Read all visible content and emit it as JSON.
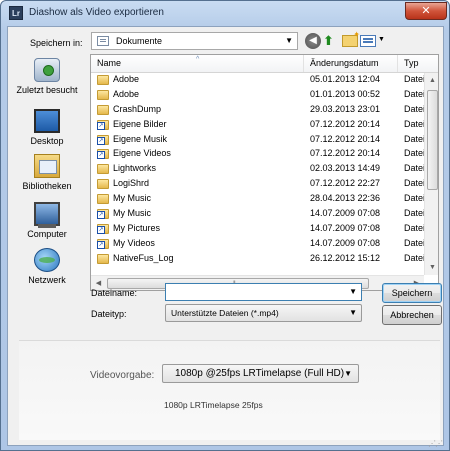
{
  "window": {
    "title": "Diashow als Video exportieren",
    "app_icon_text": "Lr",
    "close_glyph": "✕"
  },
  "toolbar": {
    "look_in_label": "Speichern in:",
    "look_in_value": "Dokumente",
    "icons": [
      "back-icon",
      "up-folder-icon",
      "new-folder-icon",
      "view-menu-icon"
    ]
  },
  "places": [
    {
      "label": "Zuletzt besucht",
      "icon": "recent-places-icon"
    },
    {
      "label": "Desktop",
      "icon": "desktop-icon"
    },
    {
      "label": "Bibliotheken",
      "icon": "libraries-icon"
    },
    {
      "label": "Computer",
      "icon": "computer-icon"
    },
    {
      "label": "Netzwerk",
      "icon": "network-icon"
    }
  ],
  "filelist": {
    "columns": [
      "Name",
      "Änderungsdatum",
      "Typ"
    ],
    "rows": [
      {
        "name": "Adobe",
        "date": "05.01.2013 12:04",
        "type": "Dateio",
        "link": false
      },
      {
        "name": "Adobe",
        "date": "01.01.2013 00:52",
        "type": "Dateio",
        "link": false
      },
      {
        "name": "CrashDump",
        "date": "29.03.2013 23:01",
        "type": "Dateio",
        "link": false
      },
      {
        "name": "Eigene Bilder",
        "date": "07.12.2012 20:14",
        "type": "Dateio",
        "link": true
      },
      {
        "name": "Eigene Musik",
        "date": "07.12.2012 20:14",
        "type": "Dateio",
        "link": true
      },
      {
        "name": "Eigene Videos",
        "date": "07.12.2012 20:14",
        "type": "Dateio",
        "link": true
      },
      {
        "name": "Lightworks",
        "date": "02.03.2013 14:49",
        "type": "Dateio",
        "link": false
      },
      {
        "name": "LogiShrd",
        "date": "07.12.2012 22:27",
        "type": "Dateio",
        "link": false
      },
      {
        "name": "My Music",
        "date": "28.04.2013 22:36",
        "type": "Dateio",
        "link": false
      },
      {
        "name": "My Music",
        "date": "14.07.2009 07:08",
        "type": "Dateio",
        "link": true
      },
      {
        "name": "My Pictures",
        "date": "14.07.2009 07:08",
        "type": "Dateio",
        "link": true
      },
      {
        "name": "My Videos",
        "date": "14.07.2009 07:08",
        "type": "Dateio",
        "link": true
      },
      {
        "name": "NativeFus_Log",
        "date": "26.12.2012 15:12",
        "type": "Dateio",
        "link": false
      }
    ]
  },
  "form": {
    "filename_label": "Dateiname:",
    "filename_value": "",
    "filetype_label": "Dateityp:",
    "filetype_value": "Unterstützte Dateien (*.mp4)",
    "save_label": "Speichern",
    "cancel_label": "Abbrechen"
  },
  "preset": {
    "label": "Videovorgabe:",
    "value": "1080p @25fps LRTimelapse (Full HD)",
    "description": "1080p LRTimelapse 25fps"
  }
}
